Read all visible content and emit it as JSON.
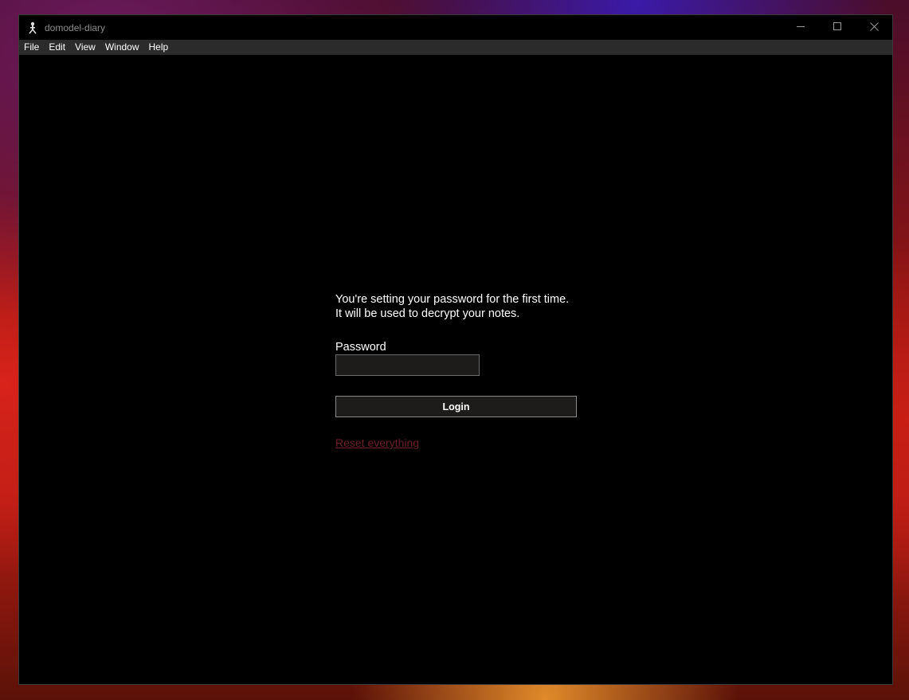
{
  "window": {
    "title": "domodel-diary",
    "controls": {
      "minimize_icon": "minimize-icon",
      "maximize_icon": "maximize-icon",
      "close_icon": "close-icon"
    }
  },
  "menubar": {
    "items": [
      {
        "label": "File"
      },
      {
        "label": "Edit"
      },
      {
        "label": "View"
      },
      {
        "label": "Window"
      },
      {
        "label": "Help"
      }
    ]
  },
  "login": {
    "intro_line1": "You're setting your password for the first time.",
    "intro_line2": "It will be used to decrypt your notes.",
    "password_label": "Password",
    "password_value": "",
    "login_button": "Login",
    "reset_link": "Reset everything"
  },
  "colors": {
    "background": "#000000",
    "menubar": "#2b2b2b",
    "input_background": "#1e1b1b",
    "reset_link": "#6e1f2a",
    "text": "#ffffff"
  }
}
